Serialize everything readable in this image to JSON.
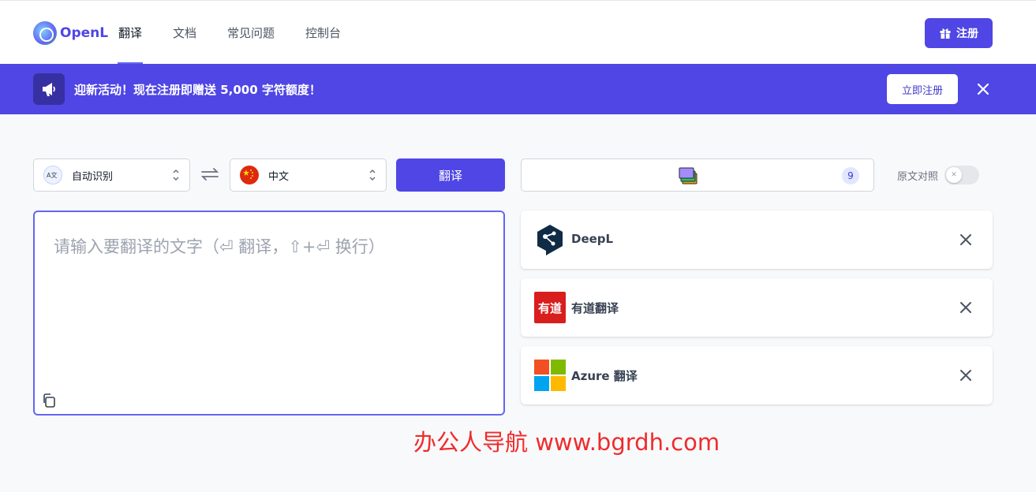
{
  "header": {
    "logo_text": "OpenL",
    "nav": [
      {
        "label": "翻译",
        "active": true
      },
      {
        "label": "文档",
        "active": false
      },
      {
        "label": "常见问题",
        "active": false
      },
      {
        "label": "控制台",
        "active": false
      }
    ],
    "signup_label": "注册"
  },
  "banner": {
    "text": "迎新活动！现在注册即赠送 5,000 字符额度！",
    "cta_label": "立即注册"
  },
  "toolbar": {
    "source_lang": "自动识别",
    "target_lang": "中文",
    "translate_label": "翻译",
    "engine_count": "9",
    "original_compare_label": "原文对照",
    "original_compare_on": false
  },
  "input": {
    "placeholder": "请输入要翻译的文字（⏎ 翻译，⇧+⏎ 换行）",
    "value": ""
  },
  "engines": [
    {
      "name": "DeepL",
      "icon": "deepl-logo"
    },
    {
      "name": "有道翻译",
      "icon": "youdao-logo",
      "logo_text": "有道"
    },
    {
      "name": "Azure 翻译",
      "icon": "microsoft-logo"
    }
  ],
  "watermark": "办公人导航 www.bgrdh.com",
  "colors": {
    "primary": "#4f46e5",
    "banner": "#4f46e5",
    "youdao_red": "#d91e1e",
    "deepl_navy": "#0f2b46",
    "watermark": "#ef2b2b"
  }
}
